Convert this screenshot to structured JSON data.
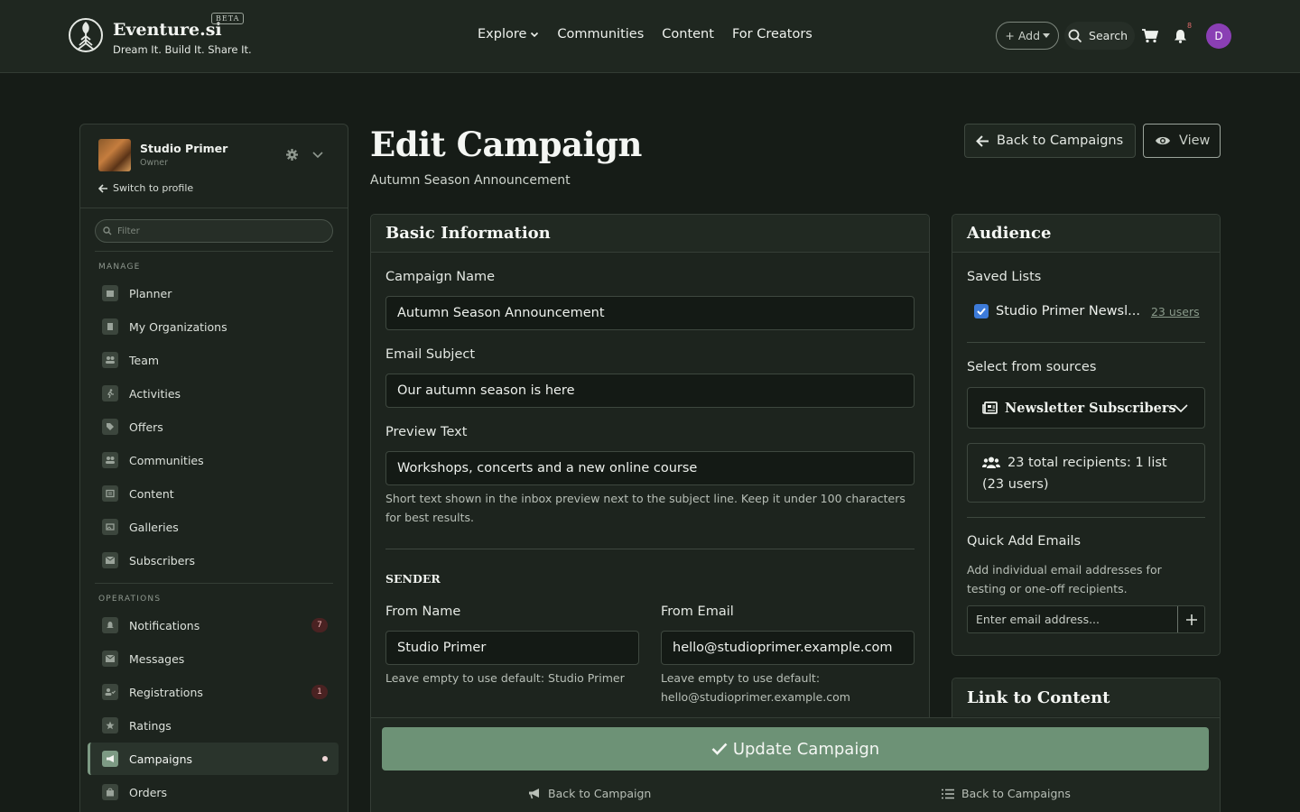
{
  "nav": {
    "brand": "Eventure.si",
    "beta": "BETA",
    "tagline": "Dream It. Build It. Share It.",
    "links": [
      "Explore",
      "Communities",
      "Content",
      "For Creators"
    ],
    "add_label": "+ Add",
    "search_label": "Search",
    "notification_count": "8",
    "avatar_initial": "D"
  },
  "sidebar": {
    "profile_name": "Studio Primer",
    "profile_role": "Owner",
    "switch_label": "Switch to profile",
    "filter_placeholder": "Filter",
    "manage_title": "MANAGE",
    "manage_items": [
      "Planner",
      "My Organizations",
      "Team",
      "Activities",
      "Offers",
      "Communities",
      "Content",
      "Galleries",
      "Subscribers"
    ],
    "operations_title": "OPERATIONS",
    "operations_items": [
      "Notifications",
      "Messages",
      "Registrations",
      "Ratings",
      "Campaigns",
      "Orders"
    ],
    "notifications_count": "7",
    "registrations_count": "1"
  },
  "header": {
    "title": "Edit Campaign",
    "subtitle": "Autumn Season Announcement",
    "back_label": "Back to Campaigns",
    "view_label": "View"
  },
  "basic": {
    "title": "Basic Information",
    "name_label": "Campaign Name",
    "name_value": "Autumn Season Announcement",
    "subject_label": "Email Subject",
    "subject_value": "Our autumn season is here",
    "preview_label": "Preview Text",
    "preview_value": "Workshops, concerts and a new online course",
    "preview_help_1": "Short text shown in the inbox preview next to the subject line. Keep it under 100 characters",
    "preview_help_2": "for best results.",
    "sender_title": "SENDER",
    "from_name_label": "From Name",
    "from_name_value": "Studio Primer",
    "from_name_help": "Leave empty to use default: Studio Primer",
    "from_email_label": "From Email",
    "from_email_value": "hello@studioprimer.example.com",
    "from_email_help_1": "Leave empty to use default:",
    "from_email_help_2": "hello@studioprimer.example.com"
  },
  "audience": {
    "title": "Audience",
    "saved_label": "Saved Lists",
    "list_name": "Studio Primer Newsl...",
    "list_users": "23 users",
    "sources_label": "Select from sources",
    "source_value": "Newsletter Subscribers",
    "recipients_1": "23 total recipients: 1 list",
    "recipients_2": "(23 users)",
    "quick_label": "Quick Add Emails",
    "quick_help_1": "Add individual email addresses for",
    "quick_help_2": "testing or one-off recipients.",
    "email_placeholder": "Enter email address..."
  },
  "link_content": {
    "title": "Link to Content"
  },
  "actions": {
    "update_label": "Update Campaign",
    "back_campaign": "Back to Campaign",
    "back_campaigns": "Back to Campaigns"
  },
  "colors": {
    "background": "#161c17",
    "accent": "#6d9276",
    "avatar": "#8a3fb4",
    "checkbox": "#3d7bd9"
  }
}
